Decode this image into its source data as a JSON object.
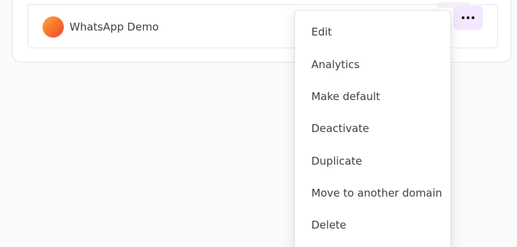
{
  "bot": {
    "name": "WhatsApp Demo",
    "avatar_colors": [
      "#fba64b",
      "#f97a2a",
      "#f0453a"
    ]
  },
  "actions": {
    "more_icon": "more-horizontal-icon",
    "accent": "#f3e8ff"
  },
  "menu": {
    "items": [
      {
        "label": "Edit"
      },
      {
        "label": "Analytics"
      },
      {
        "label": "Make default"
      },
      {
        "label": "Deactivate"
      },
      {
        "label": "Duplicate"
      },
      {
        "label": "Move to another domain"
      },
      {
        "label": "Delete"
      }
    ]
  }
}
